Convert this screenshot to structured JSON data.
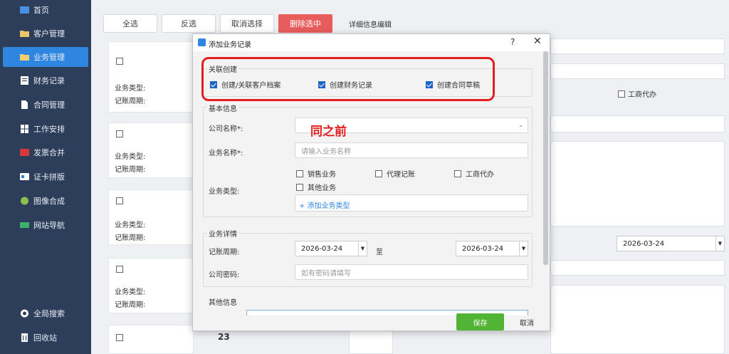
{
  "sidebar": {
    "items": [
      {
        "label": "首页",
        "icon": "home-icon"
      },
      {
        "label": "客户管理",
        "icon": "folder-icon"
      },
      {
        "label": "业务管理",
        "icon": "folder-icon"
      },
      {
        "label": "财务记录",
        "icon": "ledger-icon"
      },
      {
        "label": "合同管理",
        "icon": "document-icon"
      },
      {
        "label": "工作安排",
        "icon": "grid-icon"
      },
      {
        "label": "发票合并",
        "icon": "pdf-icon"
      },
      {
        "label": "证卡拼版",
        "icon": "card-icon"
      },
      {
        "label": "图像合成",
        "icon": "image-icon"
      },
      {
        "label": "网站导航",
        "icon": "nav-icon"
      }
    ],
    "bottom_items": [
      {
        "label": "全局搜索",
        "icon": "search-icon"
      },
      {
        "label": "回收站",
        "icon": "trash-icon"
      }
    ],
    "active_index": 2
  },
  "toolbar": {
    "select_all": "全选",
    "invert": "反选",
    "deselect": "取消选择",
    "delete_selected": "删除选中"
  },
  "cards": {
    "type_label": "业务类型:",
    "period_label": "记账周期:",
    "partial_number": "23"
  },
  "detail": {
    "title": "详细信息编辑",
    "gongshang_label": "工商代办",
    "date": "2026-03-24"
  },
  "dialog": {
    "title": "添加业务记录",
    "help": "?",
    "close": "✕",
    "link_section": {
      "title": "关联创建",
      "options": [
        {
          "label": "创建/关联客户档案",
          "checked": true
        },
        {
          "label": "创建财务记录",
          "checked": true
        },
        {
          "label": "创建合同草稿",
          "checked": true
        }
      ]
    },
    "basic_section": {
      "title": "基本信息",
      "company_label": "公司名称*:",
      "business_name_label": "业务名称*:",
      "business_name_placeholder": "请输入业务名称",
      "business_type_label": "业务类型:",
      "types": [
        "销售业务",
        "代理记账",
        "工商代办",
        "其他业务"
      ],
      "add_type": "+ 添加业务类型"
    },
    "detail_section": {
      "title": "业务详情",
      "period_label": "记账周期:",
      "start_date": "2026-03-24",
      "to": "至",
      "end_date": "2026-03-24",
      "password_label": "公司密码:",
      "password_placeholder": "如有密码请填写"
    },
    "other_section": {
      "title": "其他信息"
    },
    "save": "保存",
    "cancel": "取消"
  },
  "annotation": {
    "text": "同之前",
    "color": "#e41e1e"
  }
}
